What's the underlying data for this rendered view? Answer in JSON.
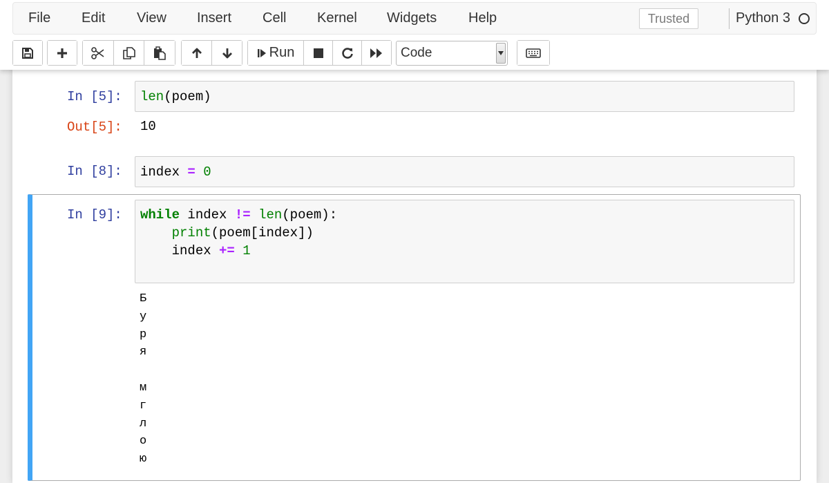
{
  "menubar": {
    "items": [
      "File",
      "Edit",
      "View",
      "Insert",
      "Cell",
      "Kernel",
      "Widgets",
      "Help"
    ],
    "trusted_label": "Trusted",
    "kernel_name": "Python 3"
  },
  "toolbar": {
    "icons": {
      "save": "save-icon",
      "insert": "plus-icon",
      "cut": "scissors-icon",
      "copy": "copy-icon",
      "paste": "paste-icon",
      "move_up": "arrow-up-icon",
      "move_down": "arrow-down-icon",
      "run": "step-forward-icon",
      "interrupt": "stop-icon",
      "restart": "restart-icon",
      "run_all": "fast-forward-icon",
      "keyboard": "keyboard-icon"
    },
    "run_label": "Run",
    "cell_type": "Code"
  },
  "cells": [
    {
      "in_prompt": "In [5]:",
      "code": "len(poem)",
      "out_prompt": "Out[5]:",
      "output": "10"
    },
    {
      "in_prompt": "In [8]:",
      "code": "index = 0"
    },
    {
      "in_prompt": "In [9]:",
      "code": "while index != len(poem):\n    print(poem[index])\n    index += 1",
      "stdout": [
        "Б",
        "у",
        "р",
        "я",
        "",
        "м",
        "г",
        "л",
        "о",
        "ю"
      ],
      "selected": true
    }
  ],
  "colors": {
    "prompt_in": "#303f9f",
    "prompt_out": "#d84315",
    "selected_cell_bar": "#42a5f5",
    "keyword": "#008000",
    "operator": "#aa22ff"
  }
}
